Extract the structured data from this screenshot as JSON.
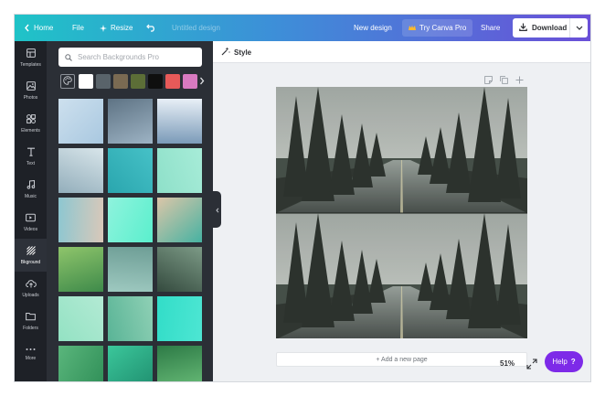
{
  "topbar": {
    "home_label": "Home",
    "file_label": "File",
    "resize_label": "Resize",
    "design_title": "Untitled design",
    "new_design_label": "New design",
    "pro_label": "Try Canva Pro",
    "share_label": "Share",
    "download_label": "Download"
  },
  "nav": {
    "items": [
      {
        "label": "Templates",
        "icon": "templates-icon"
      },
      {
        "label": "Photos",
        "icon": "photos-icon"
      },
      {
        "label": "Elements",
        "icon": "elements-icon"
      },
      {
        "label": "Text",
        "icon": "text-icon"
      },
      {
        "label": "Music",
        "icon": "music-icon"
      },
      {
        "label": "Videos",
        "icon": "videos-icon"
      },
      {
        "label": "Bkground",
        "icon": "background-icon"
      },
      {
        "label": "Uploads",
        "icon": "uploads-icon"
      },
      {
        "label": "Folders",
        "icon": "folders-icon"
      },
      {
        "label": "More",
        "icon": "more-icon"
      }
    ],
    "active_index": 6
  },
  "panel": {
    "search_placeholder": "Search Backgrounds Pro",
    "swatches": [
      "#ffffff",
      "#59636a",
      "#7a6a52",
      "#5c6e37",
      "#0f0f0f",
      "#e75a59",
      "#d87ac0"
    ],
    "thumbnails": [
      {
        "colors": [
          "#cde0ee",
          "#a9c8e0"
        ]
      },
      {
        "colors": [
          "#5e7384",
          "#9db3c4"
        ]
      },
      {
        "colors": [
          "#e9f0f7",
          "#7a9ab8"
        ]
      },
      {
        "colors": [
          "#d8e5ea",
          "#93aebb"
        ]
      },
      {
        "colors": [
          "#46c1c7",
          "#2aa6ae"
        ]
      },
      {
        "colors": [
          "#a7ecd8",
          "#8ee0c9"
        ]
      },
      {
        "colors": [
          "#d9c8b9",
          "#8dc7d1"
        ]
      },
      {
        "colors": [
          "#5aefcd",
          "#8ff3dd"
        ]
      },
      {
        "colors": [
          "#46b2a2",
          "#dcc6a8"
        ]
      },
      {
        "colors": [
          "#3e8a4a",
          "#8fc56b"
        ]
      },
      {
        "colors": [
          "#9ec9c0",
          "#6e9e96"
        ]
      },
      {
        "colors": [
          "#344a3e",
          "#7c9a86"
        ]
      },
      {
        "colors": [
          "#93e2c3",
          "#b3ead4"
        ]
      },
      {
        "colors": [
          "#59b496",
          "#8fd0b5"
        ]
      },
      {
        "colors": [
          "#32ddc8",
          "#4de6d3"
        ]
      },
      {
        "colors": [
          "#5ab67c",
          "#2f8e57"
        ]
      },
      {
        "colors": [
          "#3bc79b",
          "#1f8d6e"
        ]
      },
      {
        "colors": [
          "#2d7a46",
          "#6bbf7a"
        ]
      }
    ]
  },
  "editor": {
    "style_label": "Style",
    "add_page_label": "+ Add a new page",
    "zoom_label": "51%",
    "help_label": "Help",
    "help_mark": "?"
  }
}
